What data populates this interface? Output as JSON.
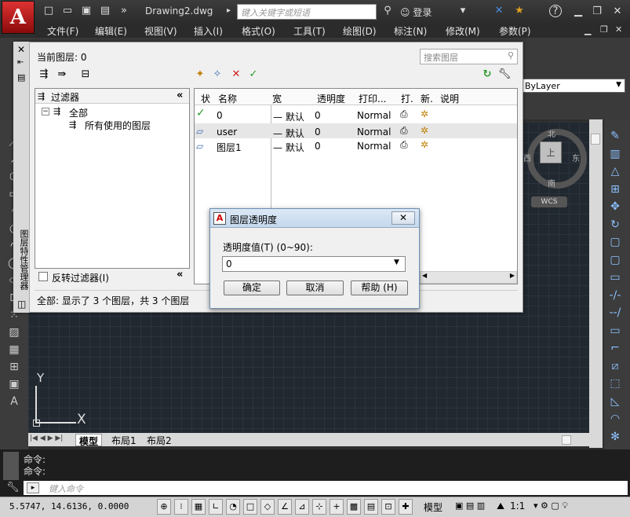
{
  "app": {
    "logo": "A",
    "doc_title": "Drawing2.dwg",
    "search_placeholder": "键入关键字或短语",
    "login": "登录",
    "help": "?"
  },
  "menus": [
    "文件(F)",
    "编辑(E)",
    "视图(V)",
    "插入(I)",
    "格式(O)",
    "工具(T)",
    "绘图(D)",
    "标注(N)",
    "修改(M)",
    "参数(P)"
  ],
  "property_bar": {
    "bylayer": "ByLayer"
  },
  "viewcube": {
    "north": "北",
    "south": "南",
    "east": "东",
    "west": "西",
    "center": "上",
    "wcs": "WCS"
  },
  "ucs": {
    "x": "X",
    "y": "Y"
  },
  "layout_tabs": [
    "模型",
    "布局1",
    "布局2"
  ],
  "command": {
    "line1": "命令:",
    "line2": "命令:",
    "input_placeholder": "键入命令"
  },
  "status": {
    "coords": "5.5747,   14.6136, 0.0000",
    "model": "模型",
    "scale": "1:1"
  },
  "layer_manager": {
    "vertical_title": "图层特性管理器",
    "current_layer": "当前图层: 0",
    "search_placeholder": "搜索图层",
    "filters_title": "过滤器",
    "tree": [
      {
        "label": "全部"
      },
      {
        "label": "所有使用的图层"
      }
    ],
    "invert_filter": "反转过滤器(I)",
    "columns": [
      "状",
      "名称",
      "宽",
      "透明度",
      "打印...",
      "打.",
      "新.",
      "说明"
    ],
    "rows": [
      {
        "name": "0",
        "width": "默认",
        "transparency": "0",
        "plot_style": "Normal",
        "current": true
      },
      {
        "name": "user",
        "width": "默认",
        "transparency": "0",
        "plot_style": "Normal",
        "current": false
      },
      {
        "name": "图层1",
        "width": "默认",
        "transparency": "0",
        "plot_style": "Normal",
        "current": false
      }
    ],
    "status": "全部: 显示了 3 个图层，共 3 个图层"
  },
  "transparency_dialog": {
    "title": "图层透明度",
    "label": "透明度值(T) (0~90):",
    "value": "0",
    "ok": "确定",
    "cancel": "取消",
    "help": "帮助 (H)"
  },
  "colors": {
    "accent_red": "#cc2222",
    "check_green": "#2a9a2a",
    "canvas": "#212830"
  }
}
